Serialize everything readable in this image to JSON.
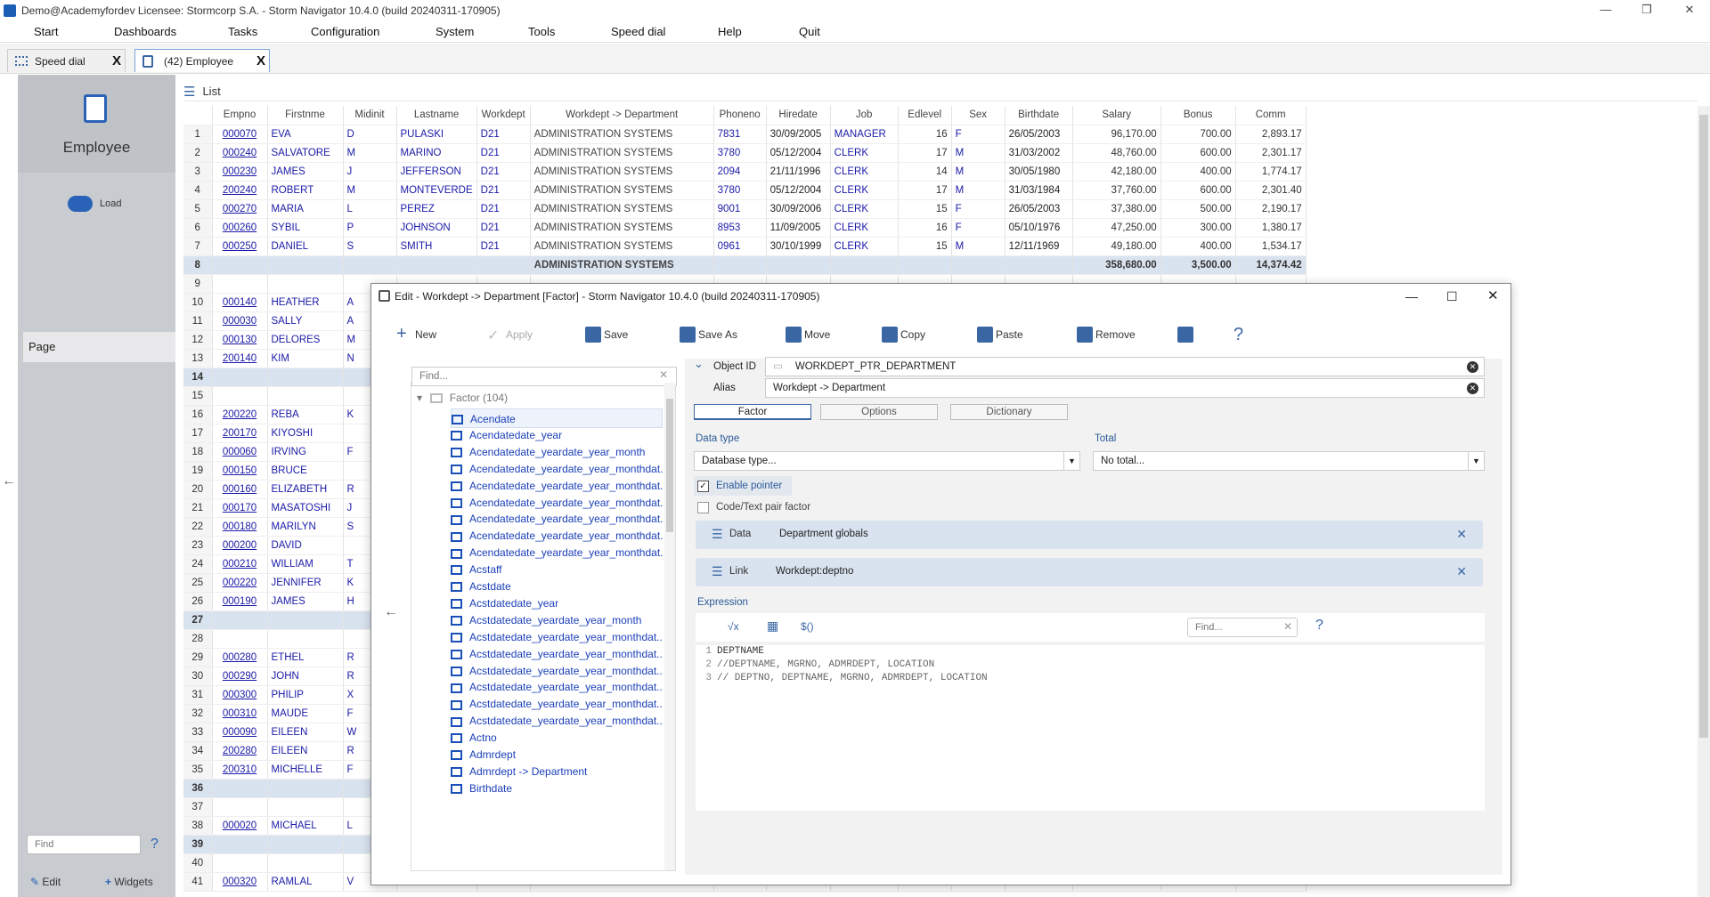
{
  "window": {
    "title": "Demo@Academyfordev   Licensee: Stormcorp S.A. -  Storm Navigator 10.4.0 (build 20240311-170905)",
    "min": "—",
    "max": "❐",
    "close": "✕"
  },
  "menu": [
    "Start",
    "Dashboards",
    "Tasks",
    "Configuration",
    "System",
    "Tools",
    "Speed dial",
    "Help",
    "Quit"
  ],
  "tabs": [
    {
      "label": "Speed dial",
      "close": "X"
    },
    {
      "label": "(42) Employee",
      "close": "X"
    }
  ],
  "sidebar": {
    "module": "Employee",
    "load": "Load",
    "page": "Page",
    "find_placeholder": "Find",
    "help": "?",
    "edit": "Edit",
    "widgets": "Widgets",
    "back": "←"
  },
  "list": {
    "title": "List",
    "columns": [
      "Empno",
      "Firstnme",
      "Midinit",
      "Lastname",
      "Workdept",
      "Workdept -> Department",
      "Phoneno",
      "Hiredate",
      "Job",
      "Edlevel",
      "Sex",
      "Birthdate",
      "Salary",
      "Bonus",
      "Comm"
    ],
    "rows": [
      [
        "1",
        "000070",
        "EVA",
        "D",
        "PULASKI",
        "D21",
        "ADMINISTRATION SYSTEMS",
        "7831",
        "30/09/2005",
        "MANAGER",
        "16",
        "F",
        "26/05/2003",
        "96,170.00",
        "700.00",
        "2,893.17"
      ],
      [
        "2",
        "000240",
        "SALVATORE",
        "M",
        "MARINO",
        "D21",
        "ADMINISTRATION SYSTEMS",
        "3780",
        "05/12/2004",
        "CLERK",
        "17",
        "M",
        "31/03/2002",
        "48,760.00",
        "600.00",
        "2,301.17"
      ],
      [
        "3",
        "000230",
        "JAMES",
        "J",
        "JEFFERSON",
        "D21",
        "ADMINISTRATION SYSTEMS",
        "2094",
        "21/11/1996",
        "CLERK",
        "14",
        "M",
        "30/05/1980",
        "42,180.00",
        "400.00",
        "1,774.17"
      ],
      [
        "4",
        "200240",
        "ROBERT",
        "M",
        "MONTEVERDE",
        "D21",
        "ADMINISTRATION SYSTEMS",
        "3780",
        "05/12/2004",
        "CLERK",
        "17",
        "M",
        "31/03/1984",
        "37,760.00",
        "600.00",
        "2,301.40"
      ],
      [
        "5",
        "000270",
        "MARIA",
        "L",
        "PEREZ",
        "D21",
        "ADMINISTRATION SYSTEMS",
        "9001",
        "30/09/2006",
        "CLERK",
        "15",
        "F",
        "26/05/2003",
        "37,380.00",
        "500.00",
        "2,190.17"
      ],
      [
        "6",
        "000260",
        "SYBIL",
        "P",
        "JOHNSON",
        "D21",
        "ADMINISTRATION SYSTEMS",
        "8953",
        "11/09/2005",
        "CLERK",
        "16",
        "F",
        "05/10/1976",
        "47,250.00",
        "300.00",
        "1,380.17"
      ],
      [
        "7",
        "000250",
        "DANIEL",
        "S",
        "SMITH",
        "D21",
        "ADMINISTRATION SYSTEMS",
        "0961",
        "30/10/1999",
        "CLERK",
        "15",
        "M",
        "12/11/1969",
        "49,180.00",
        "400.00",
        "1,534.17"
      ],
      [
        "8",
        "",
        "",
        "",
        "",
        "",
        "ADMINISTRATION SYSTEMS",
        "",
        "",
        "",
        "",
        "",
        "",
        "358,680.00",
        "3,500.00",
        "14,374.42"
      ],
      [
        "9",
        "",
        "",
        "",
        "",
        "",
        "",
        "",
        "",
        "",
        "",
        "",
        "",
        "",
        "",
        ""
      ],
      [
        "10",
        "000140",
        "HEATHER",
        "A",
        "",
        "",
        "",
        "",
        "",
        "",
        "",
        "",
        "",
        "",
        "",
        ""
      ],
      [
        "11",
        "000030",
        "SALLY",
        "A",
        "",
        "",
        "",
        "",
        "",
        "",
        "",
        "",
        "",
        "",
        "",
        ""
      ],
      [
        "12",
        "000130",
        "DELORES",
        "M",
        "",
        "",
        "",
        "",
        "",
        "",
        "",
        "",
        "",
        "",
        "",
        ""
      ],
      [
        "13",
        "200140",
        "KIM",
        "N",
        "",
        "",
        "",
        "",
        "",
        "",
        "",
        "",
        "",
        "",
        "",
        ""
      ],
      [
        "14",
        "",
        "",
        "",
        "",
        "",
        "",
        "",
        "",
        "",
        "",
        "",
        "",
        "",
        "",
        ""
      ],
      [
        "15",
        "",
        "",
        "",
        "",
        "",
        "",
        "",
        "",
        "",
        "",
        "",
        "",
        "",
        "",
        ""
      ],
      [
        "16",
        "200220",
        "REBA",
        "K",
        "",
        "",
        "",
        "",
        "",
        "",
        "",
        "",
        "",
        "",
        "",
        ""
      ],
      [
        "17",
        "200170",
        "KIYOSHI",
        "",
        "",
        "",
        "",
        "",
        "",
        "",
        "",
        "",
        "",
        "",
        "",
        ""
      ],
      [
        "18",
        "000060",
        "IRVING",
        "F",
        "",
        "",
        "",
        "",
        "",
        "",
        "",
        "",
        "",
        "",
        "",
        ""
      ],
      [
        "19",
        "000150",
        "BRUCE",
        "",
        "",
        "",
        "",
        "",
        "",
        "",
        "",
        "",
        "",
        "",
        "",
        ""
      ],
      [
        "20",
        "000160",
        "ELIZABETH",
        "R",
        "",
        "",
        "",
        "",
        "",
        "",
        "",
        "",
        "",
        "",
        "",
        ""
      ],
      [
        "21",
        "000170",
        "MASATOSHI",
        "J",
        "",
        "",
        "",
        "",
        "",
        "",
        "",
        "",
        "",
        "",
        "",
        ""
      ],
      [
        "22",
        "000180",
        "MARILYN",
        "S",
        "",
        "",
        "",
        "",
        "",
        "",
        "",
        "",
        "",
        "",
        "",
        ""
      ],
      [
        "23",
        "000200",
        "DAVID",
        "",
        "",
        "",
        "",
        "",
        "",
        "",
        "",
        "",
        "",
        "",
        "",
        ""
      ],
      [
        "24",
        "000210",
        "WILLIAM",
        "T",
        "",
        "",
        "",
        "",
        "",
        "",
        "",
        "",
        "",
        "",
        "",
        ""
      ],
      [
        "25",
        "000220",
        "JENNIFER",
        "K",
        "",
        "",
        "",
        "",
        "",
        "",
        "",
        "",
        "",
        "",
        "",
        ""
      ],
      [
        "26",
        "000190",
        "JAMES",
        "H",
        "",
        "",
        "",
        "",
        "",
        "",
        "",
        "",
        "",
        "",
        "",
        ""
      ],
      [
        "27",
        "",
        "",
        "",
        "",
        "",
        "",
        "",
        "",
        "",
        "",
        "",
        "",
        "",
        "",
        ""
      ],
      [
        "28",
        "",
        "",
        "",
        "",
        "",
        "",
        "",
        "",
        "",
        "",
        "",
        "",
        "",
        "",
        ""
      ],
      [
        "29",
        "000280",
        "ETHEL",
        "R",
        "",
        "",
        "",
        "",
        "",
        "",
        "",
        "",
        "",
        "",
        "",
        ""
      ],
      [
        "30",
        "000290",
        "JOHN",
        "R",
        "",
        "",
        "",
        "",
        "",
        "",
        "",
        "",
        "",
        "",
        "",
        ""
      ],
      [
        "31",
        "000300",
        "PHILIP",
        "X",
        "",
        "",
        "",
        "",
        "",
        "",
        "",
        "",
        "",
        "",
        "",
        ""
      ],
      [
        "32",
        "000310",
        "MAUDE",
        "F",
        "",
        "",
        "",
        "",
        "",
        "",
        "",
        "",
        "",
        "",
        "",
        ""
      ],
      [
        "33",
        "000090",
        "EILEEN",
        "W",
        "",
        "",
        "",
        "",
        "",
        "",
        "",
        "",
        "",
        "",
        "",
        ""
      ],
      [
        "34",
        "200280",
        "EILEEN",
        "R",
        "",
        "",
        "",
        "",
        "",
        "",
        "",
        "",
        "",
        "",
        "",
        ""
      ],
      [
        "35",
        "200310",
        "MICHELLE",
        "F",
        "",
        "",
        "",
        "",
        "",
        "",
        "",
        "",
        "",
        "",
        "",
        ""
      ],
      [
        "36",
        "",
        "",
        "",
        "",
        "",
        "",
        "",
        "",
        "",
        "",
        "",
        "",
        "",
        "",
        ""
      ],
      [
        "37",
        "",
        "",
        "",
        "",
        "",
        "",
        "",
        "",
        "",
        "",
        "",
        "",
        "",
        "",
        ""
      ],
      [
        "38",
        "000020",
        "MICHAEL",
        "L",
        "",
        "",
        "",
        "",
        "",
        "",
        "",
        "",
        "",
        "",
        "",
        ""
      ],
      [
        "39",
        "",
        "",
        "",
        "",
        "",
        "",
        "",
        "",
        "",
        "",
        "",
        "",
        "",
        "",
        ""
      ],
      [
        "40",
        "",
        "",
        "",
        "",
        "",
        "",
        "",
        "",
        "",
        "",
        "",
        "",
        "",
        "",
        ""
      ],
      [
        "41",
        "000320",
        "RAMLAL",
        "V",
        "",
        "",
        "",
        "",
        "",
        "",
        "",
        "",
        "",
        "",
        "",
        ""
      ]
    ],
    "group_rows": [
      "8",
      "14",
      "27",
      "36",
      "39"
    ]
  },
  "dialog": {
    "title": "Edit - Workdept -> Department [Factor] -  Storm Navigator 10.4.0 (build 20240311-170905)",
    "toolbar": [
      {
        "label": "New",
        "enabled": true
      },
      {
        "label": "Apply",
        "enabled": false
      },
      {
        "label": "Save",
        "enabled": true
      },
      {
        "label": "Save As",
        "enabled": true
      },
      {
        "label": "Move",
        "enabled": true
      },
      {
        "label": "Copy",
        "enabled": true
      },
      {
        "label": "Paste",
        "enabled": true
      },
      {
        "label": "Remove",
        "enabled": true
      },
      {
        "label": "",
        "enabled": true
      },
      {
        "label": "?",
        "enabled": true
      }
    ],
    "tree": {
      "find_placeholder": "Find...",
      "root": "Factor (104)",
      "items": [
        "Acendate",
        "Acendatedate_year",
        "Acendatedate_yeardate_year_month",
        "Acendatedate_yeardate_year_monthdat...",
        "Acendatedate_yeardate_year_monthdat...",
        "Acendatedate_yeardate_year_monthdat...",
        "Acendatedate_yeardate_year_monthdat...",
        "Acendatedate_yeardate_year_monthdat...",
        "Acendatedate_yeardate_year_monthdat...",
        "Acstaff",
        "Acstdate",
        "Acstdatedate_year",
        "Acstdatedate_yeardate_year_month",
        "Acstdatedate_yeardate_year_monthdat...",
        "Acstdatedate_yeardate_year_monthdat...",
        "Acstdatedate_yeardate_year_monthdat...",
        "Acstdatedate_yeardate_year_monthdat...",
        "Acstdatedate_yeardate_year_monthdat...",
        "Acstdatedate_yeardate_year_monthdat...",
        "Actno",
        "Admrdept",
        "Admrdept -> Department",
        "Birthdate"
      ]
    },
    "object_id_label": "Object ID",
    "object_id": "WORKDEPT_PTR_DEPARTMENT",
    "alias_label": "Alias",
    "alias": "Workdept -> Department",
    "tabs": [
      "Factor",
      "Options",
      "Dictionary"
    ],
    "data_type_label": "Data type",
    "data_type": "Database type...",
    "total_label": "Total",
    "total": "No total...",
    "enable_pointer": "Enable pointer",
    "code_text": "Code/Text pair factor",
    "data_label": "Data",
    "data_value": "Department globals",
    "link_label": "Link",
    "link_value": "Workdept:deptno",
    "expression_label": "Expression",
    "expr_find": "Find...",
    "expr_help": "?",
    "expr_tools": [
      "√x",
      "▦",
      "$()"
    ],
    "code": [
      {
        "n": "1",
        "t": "DEPTNAME"
      },
      {
        "n": "2",
        "t": "//DEPTNAME, MGRNO, ADMRDEPT, LOCATION"
      },
      {
        "n": "3",
        "t": "// DEPTNO, DEPTNAME, MGRNO, ADMRDEPT, LOCATION"
      }
    ]
  }
}
